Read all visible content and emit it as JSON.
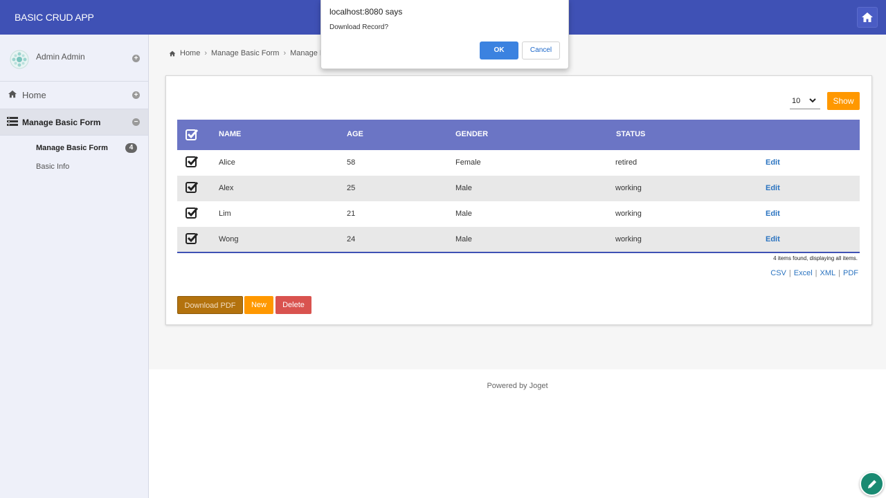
{
  "header": {
    "app_title": "BASIC CRUD APP",
    "home_icon": "home-icon"
  },
  "sidebar": {
    "profile_name": "Admin Admin",
    "home_label": "Home",
    "manage_label": "Manage Basic Form",
    "sub_items": [
      {
        "label": "Manage Basic Form",
        "count": "4"
      },
      {
        "label": "Basic Info"
      }
    ]
  },
  "breadcrumb": {
    "items": [
      "Home",
      "Manage Basic Form",
      "Manage B"
    ]
  },
  "list": {
    "page_size": "10",
    "show_label": "Show",
    "columns": [
      "NAME",
      "AGE",
      "GENDER",
      "STATUS"
    ],
    "rows": [
      {
        "name": "Alice",
        "age": "58",
        "gender": "Female",
        "status": "retired",
        "action": "Edit"
      },
      {
        "name": "Alex",
        "age": "25",
        "gender": "Male",
        "status": "working",
        "action": "Edit"
      },
      {
        "name": "Lim",
        "age": "21",
        "gender": "Male",
        "status": "working",
        "action": "Edit"
      },
      {
        "name": "Wong",
        "age": "24",
        "gender": "Male",
        "status": "working",
        "action": "Edit"
      }
    ],
    "items_found": "4 items found, displaying all items.",
    "exports": [
      "CSV",
      "Excel",
      "XML",
      "PDF"
    ]
  },
  "actions": {
    "download_pdf": "Download PDF",
    "new": "New",
    "delete": "Delete"
  },
  "dialog": {
    "title": "localhost:8080 says",
    "message": "Download Record?",
    "ok": "OK",
    "cancel": "Cancel"
  },
  "footer": {
    "text": "Powered by Joget"
  },
  "colors": {
    "header": "#3f51b5",
    "table_header": "#6b75c5",
    "orange": "#ff9800",
    "danger": "#d9534f",
    "link": "#2a73c0"
  }
}
